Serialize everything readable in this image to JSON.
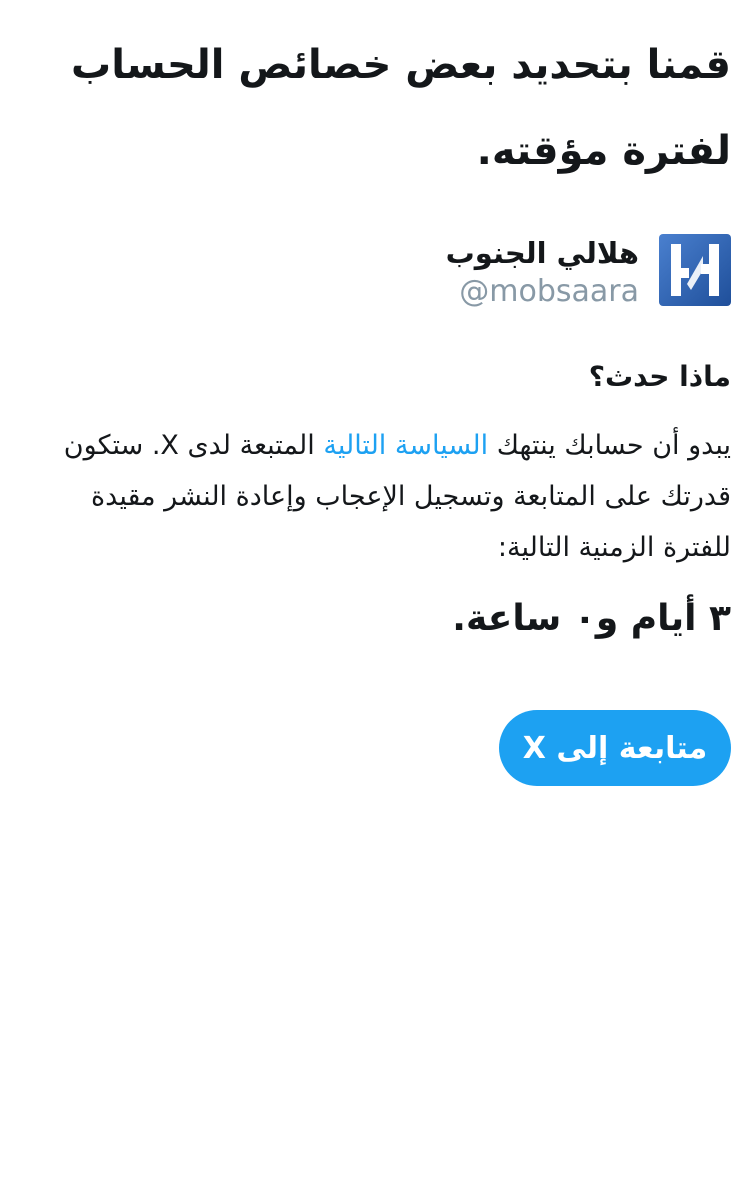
{
  "header": {
    "title": "قمنا بتحديد بعض خصائص الحساب لفترة مؤقته."
  },
  "account": {
    "display_name": "هلالي الجنوب",
    "handle": "@mobsaara",
    "avatar_icon": "hilal-logo-icon",
    "avatar_colors": {
      "background": "#3a6fc0",
      "mark": "#ffffff"
    }
  },
  "section": {
    "heading": "ماذا حدث؟"
  },
  "explanation": {
    "text_before_link": "يبدو أن حسابك ينتهك ",
    "link_text": "السياسة التالية",
    "text_after_link": " المتبعة لدى X. ستكون قدرتك على المتابعة وتسجيل الإعجاب وإعادة النشر مقيدة للفترة الزمنية التالية:"
  },
  "restriction": {
    "duration": "٣ أيام و٠ ساعة."
  },
  "actions": {
    "continue_label": "متابعة إلى X"
  },
  "colors": {
    "accent": "#1da1f2",
    "text": "#14171a",
    "muted": "#8899a6",
    "background": "#ffffff"
  }
}
